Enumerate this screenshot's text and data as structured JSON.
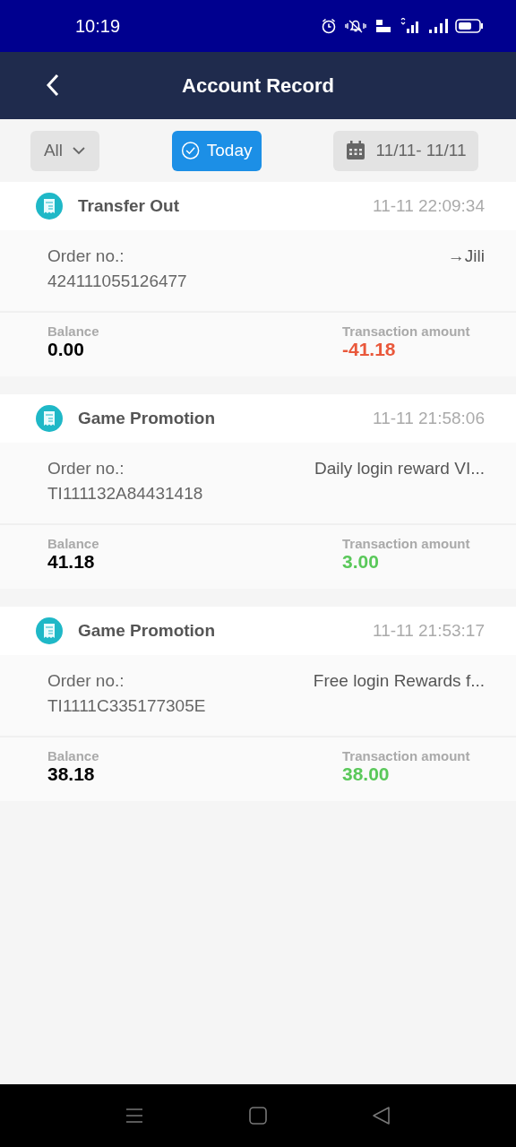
{
  "status_bar": {
    "time": "10:19"
  },
  "header": {
    "title": "Account Record"
  },
  "filters": {
    "type": {
      "label": "All"
    },
    "today": {
      "label": "Today",
      "selected": true
    },
    "date_range": {
      "label": "11/11- 11/11"
    }
  },
  "records": [
    {
      "title": "Transfer Out",
      "time": "11-11 22:09:34",
      "order_label": "Order no.:",
      "order_no": "424111055126477",
      "note": "→Jili",
      "balance_label": "Balance",
      "balance": "0.00",
      "amount_label": "Transaction amount",
      "amount": "-41.18",
      "color": "#e9583b"
    },
    {
      "title": "Game Promotion",
      "time": "11-11 21:58:06",
      "order_label": "Order no.:",
      "order_no": "TI111132A84431418",
      "note": "Daily login reward VI...",
      "balance_label": "Balance",
      "balance": "41.18",
      "amount_label": "Transaction amount",
      "amount": "3.00",
      "color": "#5ac85a"
    },
    {
      "title": "Game Promotion",
      "time": "11-11 21:53:17",
      "order_label": "Order no.:",
      "order_no": "TI1111C335177305E",
      "note": "Free login Rewards f...",
      "balance_label": "Balance",
      "balance": "38.18",
      "amount_label": "Transaction amount",
      "amount": "38.00",
      "color": "#5ac85a"
    }
  ]
}
